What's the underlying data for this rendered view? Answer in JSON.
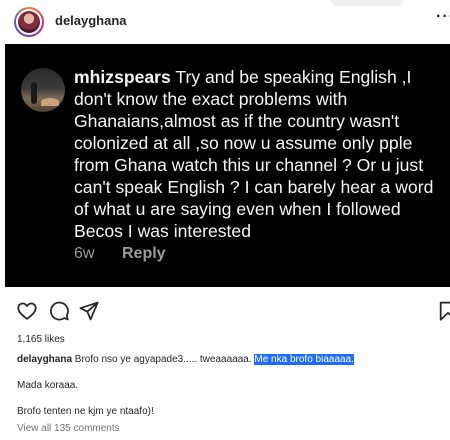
{
  "header": {
    "username": "delayghana",
    "more": "···"
  },
  "post_image": {
    "comment_username": "mhizspears",
    "comment_lines": [
      " Try and be speaking English ,I",
      "don't know the exact problems with",
      "Ghanaians,almost as if the country wasn't",
      "colonized at all ,so now u assume only pple",
      "from Ghana watch this ur channel ? Or u just",
      "can't speak English ? I can barely hear a word",
      "of what u are saying even when I followed",
      "Becos I was interested"
    ],
    "comment_age": "6w",
    "reply_label": "Reply"
  },
  "actions": {
    "like_icon": "heart-icon",
    "comment_icon": "comment-icon",
    "share_icon": "share-icon",
    "save_icon": "bookmark-icon"
  },
  "likes": "1,165 likes",
  "caption": {
    "username": "delayghana",
    "text": " Brofo nso ye agyapade3..... tweaaaaaa. ",
    "highlighted": "Me nka brofo biaaaaa.",
    "line2": "Mada koraaa.",
    "line3": "Brofo tenten ne kjm ye ntaafo)!"
  },
  "view_all_comments": "View all 135 comments",
  "colors": {
    "selection": "#1e6cff",
    "post_bg": "#000000",
    "muted": "#737373"
  }
}
